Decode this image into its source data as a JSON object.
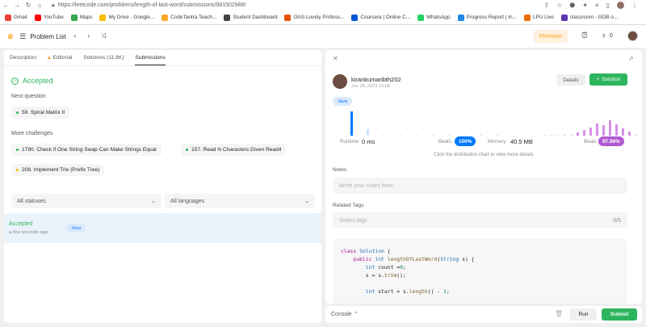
{
  "browser": {
    "url": "https://leetcode.com/problems/length-of-last-word/submissions/981502988/",
    "bookmarks": [
      {
        "label": "Gmail",
        "color": "#ea4335"
      },
      {
        "label": "YouTube",
        "color": "#ff0000"
      },
      {
        "label": "Maps",
        "color": "#34a853"
      },
      {
        "label": "My Drive - Google...",
        "color": "#fbbc04"
      },
      {
        "label": "CodeTantra Teach...",
        "color": "#f9a825"
      },
      {
        "label": "Student Dashboard",
        "color": "#424242"
      },
      {
        "label": "OAS-Lovely Profess...",
        "color": "#e65100"
      },
      {
        "label": "Coursera | Online C...",
        "color": "#0056d2"
      },
      {
        "label": "WhatsApp",
        "color": "#25d366"
      },
      {
        "label": "Progress Report | In...",
        "color": "#1e88e5"
      },
      {
        "label": "LPU Live",
        "color": "#ef6c00"
      },
      {
        "label": "classroom - GDB o...",
        "color": "#5e35b1"
      }
    ]
  },
  "header": {
    "problem_list": "Problem List",
    "premium": "Premium",
    "streak": "0"
  },
  "left": {
    "tabs": [
      "Description",
      "Editorial",
      "Solutions (11.8K)",
      "Submissions"
    ],
    "status": "Accepted",
    "next_question_label": "Next question",
    "next_question": "59. Spiral Matrix II",
    "more_label": "More challenges",
    "challenges": [
      "1790. Check if One String Swap Can Make Strings Equal",
      "157. Read N Characters Given Read4",
      "208. Implement Trie (Prefix Tree)"
    ],
    "filter_status": "All statuses",
    "filter_lang": "All languages",
    "submission": {
      "status": "Accepted",
      "time": "a few seconds ago",
      "lang": "Java"
    }
  },
  "right": {
    "username": "kirankumaribth202",
    "date": "Jun 28, 2023 15:08",
    "details_label": "Details",
    "solution_label": "Solution",
    "lang": "Java",
    "runtime_label": "Runtime",
    "runtime_value": "0 ms",
    "beats_label": "Beats",
    "runtime_beats": "100%",
    "memory_label": "Memory",
    "memory_value": "40.5 MB",
    "memory_beats": "97.96%",
    "hint": "Click the distribution chart to view more details",
    "notes_label": "Notes",
    "notes_placeholder": "Write your notes here",
    "tags_label": "Related Tags",
    "tags_placeholder": "Select tags",
    "tags_count": "0/5",
    "code": [
      "class Solution {",
      "    public int lengthOfLastWord(String s) {",
      "        int count =0;",
      "        s = s.trim();",
      "",
      "        int start = s.length() - 1;"
    ]
  },
  "chart_data": {
    "type": "bar",
    "series": [
      {
        "name": "Runtime",
        "values": [
          100,
          28,
          4,
          4,
          4,
          4,
          4,
          4,
          4,
          4
        ],
        "color": "#007aff"
      },
      {
        "name": "Memory",
        "values": [
          4,
          4,
          4,
          6,
          8,
          14,
          22,
          35,
          50,
          45,
          62,
          48,
          30,
          18,
          8
        ],
        "color": "#d78ee6"
      }
    ]
  },
  "console": {
    "label": "Console",
    "run": "Run",
    "submit": "Submit"
  },
  "colors": {
    "accent": "#ffa116",
    "success": "#2db55d",
    "info": "#007aff",
    "memory": "#b05ad2"
  }
}
